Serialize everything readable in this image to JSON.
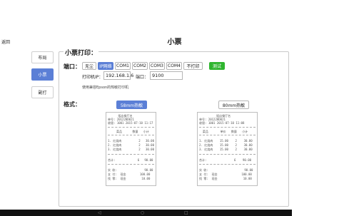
{
  "header": {
    "back_label": "返回",
    "title": "小票"
  },
  "sidebar": {
    "items": [
      {
        "label": "布局",
        "active": false
      },
      {
        "label": "小票",
        "active": true
      },
      {
        "label": "副打",
        "active": false
      }
    ]
  },
  "panel": {
    "legend": "小票打印："
  },
  "port": {
    "label": "端口：",
    "options": [
      "无尘",
      "IP网络",
      "COM1",
      "COM2",
      "COM3",
      "COM4",
      "不打印"
    ],
    "selected": "IP网络",
    "test_label": "测试",
    "ip_label": "打印机IP：",
    "ip_value": "192.168.1.6",
    "port_label": "端口：",
    "port_value": "9100",
    "note": "使用兼容Epson的热敏打印机"
  },
  "format": {
    "label": "格式：",
    "btn_58": "58mm热敏",
    "btn_80": "80mm热敏",
    "selected": "58mm热敏"
  },
  "receipt58": {
    "lines": [
      "      饭店餐厅名",
      "单号: 201228D021",
      "收银: 1001 2015-07-10 11:17",
      "     菜品      数量   小计",
      "1. 红烧肉          2   30.00",
      "2. 红烧肉          2   30.00",
      "3. 红烧肉          2   30.00",
      "合计:             6   90.00",
      "实 收:                90.00",
      "支 付:  现金        100.00",
      "找 零:  现金         10.00"
    ]
  },
  "receipt80": {
    "lines": [
      "          饭店餐厅名",
      "单号: 201228D021",
      "收银: 1001 2015-07-10 11:08",
      "  菜品       单价   数量   小计",
      "1. 红烧肉    15.00    2    30.00",
      "2. 红烧肉    15.00    2    30.00",
      "3. 红烧肉    15.00    2    30.00",
      "合计:                6    90.00",
      "实 收:                     90.00",
      "支 付:  现金              100.00",
      "找 零:  现金               10.00"
    ]
  },
  "nav": {
    "back_icon": "◁",
    "home_icon": "○",
    "recent_icon": "□"
  }
}
